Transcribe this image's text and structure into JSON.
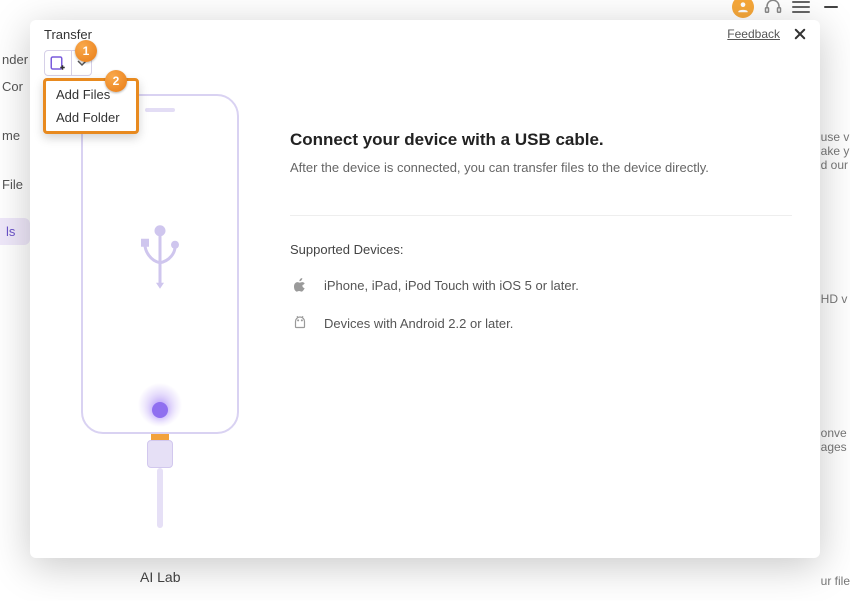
{
  "topbar": {
    "account_initial": ""
  },
  "bg": {
    "left": {
      "l0": "nder",
      "l1": "Cor",
      "l2": "me",
      "l3": "File",
      "pill": "ls"
    },
    "right": {
      "r0": "use v\nake y\nd our",
      "r1": "HD v",
      "r2": "onve\nages",
      "r3": "ur file"
    },
    "bottom": "AI Lab"
  },
  "modal": {
    "title": "Transfer",
    "feedback": "Feedback"
  },
  "toolbar": {
    "add_aria": "Add"
  },
  "dropdown": {
    "add_files": "Add Files",
    "add_folder": "Add Folder"
  },
  "callouts": {
    "one": "1",
    "two": "2"
  },
  "content": {
    "heading": "Connect your device with a USB cable.",
    "sub": "After the device is connected, you can transfer files to the device directly.",
    "supported_title": "Supported Devices:",
    "ios": "iPhone, iPad, iPod Touch with iOS 5 or later.",
    "android": "Devices with Android 2.2 or later."
  }
}
